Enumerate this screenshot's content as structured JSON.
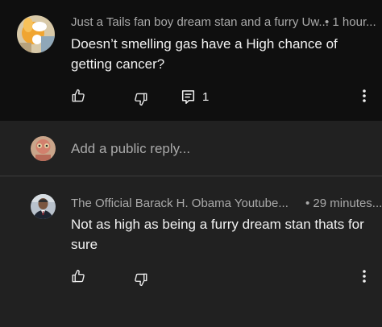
{
  "comment": {
    "author": "Just a Tails fan boy dream stan and a furry Uw...",
    "time": "• 1 hour...",
    "text": "Doesn’t smelling gas have a High chance of getting cancer?",
    "reply_count": "1",
    "icons": [
      "thumbs-up-icon",
      "thumbs-down-icon",
      "comment-icon",
      "more-vert-icon"
    ]
  },
  "reply_input": {
    "placeholder": "Add a public reply..."
  },
  "reply": {
    "author": "The Official Barack H. Obama Youtube...",
    "time": "• 29 minutes...",
    "text": "Not as high as being a furry dream stan thats for sure",
    "icons": [
      "thumbs-up-icon",
      "thumbs-down-icon",
      "more-vert-icon"
    ]
  },
  "colors": {
    "background": "#212121",
    "parent_background": "#0f0f0f",
    "primary_text": "#f1f1f1",
    "secondary_text": "#aaaaaa"
  }
}
